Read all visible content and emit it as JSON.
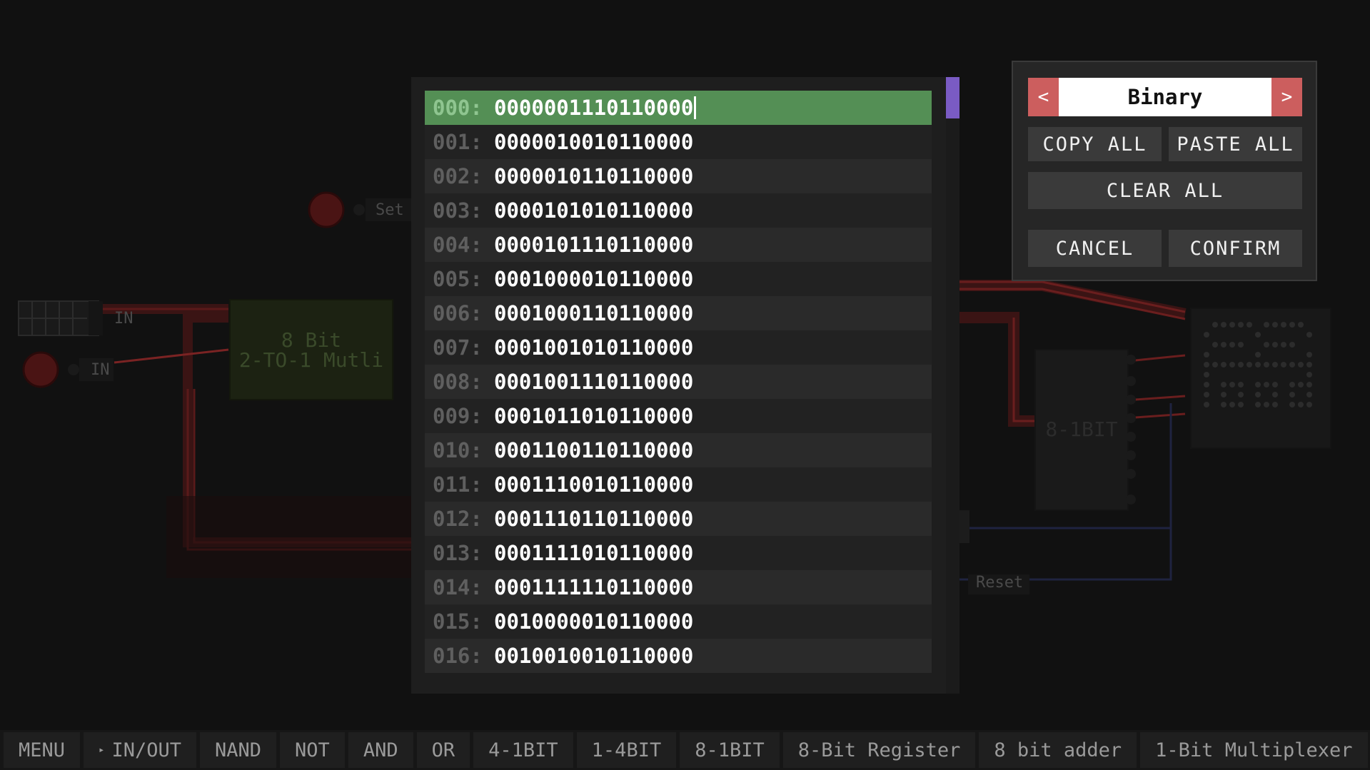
{
  "background": {
    "labels": {
      "set": "Set",
      "in_top": "IN",
      "in_bottom": "IN",
      "reset": "Reset"
    },
    "chips": {
      "mux_line1": "8 Bit",
      "mux_line2": "2-TO-1 Mutli",
      "right_chip": "8-1BIT"
    }
  },
  "memory": {
    "rows": [
      {
        "addr": "000:",
        "value": "0000001110110000"
      },
      {
        "addr": "001:",
        "value": "0000010010110000"
      },
      {
        "addr": "002:",
        "value": "0000010110110000"
      },
      {
        "addr": "003:",
        "value": "0000101010110000"
      },
      {
        "addr": "004:",
        "value": "0000101110110000"
      },
      {
        "addr": "005:",
        "value": "0001000010110000"
      },
      {
        "addr": "006:",
        "value": "0001000110110000"
      },
      {
        "addr": "007:",
        "value": "0001001010110000"
      },
      {
        "addr": "008:",
        "value": "0001001110110000"
      },
      {
        "addr": "009:",
        "value": "0001011010110000"
      },
      {
        "addr": "010:",
        "value": "0001100110110000"
      },
      {
        "addr": "011:",
        "value": "0001110010110000"
      },
      {
        "addr": "012:",
        "value": "0001110110110000"
      },
      {
        "addr": "013:",
        "value": "0001111010110000"
      },
      {
        "addr": "014:",
        "value": "0001111110110000"
      },
      {
        "addr": "015:",
        "value": "0010000010110000"
      },
      {
        "addr": "016:",
        "value": "0010010010110000"
      }
    ]
  },
  "panel": {
    "prev": "<",
    "format": "Binary",
    "next": ">",
    "copy_all": "COPY ALL",
    "paste_all": "PASTE ALL",
    "clear_all": "CLEAR ALL",
    "cancel": "CANCEL",
    "confirm": "CONFIRM"
  },
  "toolbar": {
    "items": [
      "MENU",
      "IN/OUT",
      "NAND",
      "NOT",
      "AND",
      "OR",
      "4-1BIT",
      "1-4BIT",
      "8-1BIT",
      "8-Bit Register",
      "8 bit adder",
      "1-Bit Multiplexer"
    ]
  },
  "colors": {
    "selected_row": "#548f55",
    "arrow_button": "#cc5e5e",
    "scroll_thumb": "#7a5bc4"
  }
}
